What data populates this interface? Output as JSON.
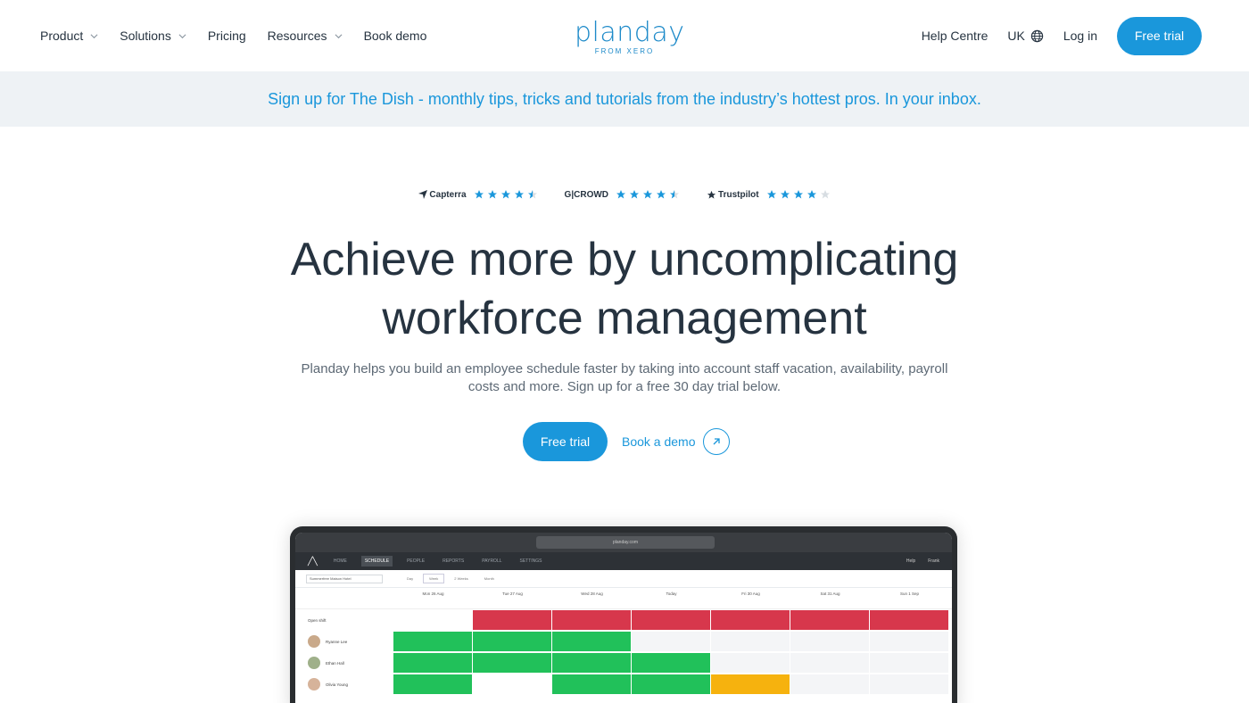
{
  "nav": {
    "items": [
      {
        "label": "Product",
        "dropdown": true
      },
      {
        "label": "Solutions",
        "dropdown": true
      },
      {
        "label": "Pricing",
        "dropdown": false
      },
      {
        "label": "Resources",
        "dropdown": true
      },
      {
        "label": "Book demo",
        "dropdown": false
      }
    ],
    "logo_main": "planday",
    "logo_sub": "FROM XERO",
    "help_centre": "Help Centre",
    "region": "UK",
    "login": "Log in",
    "trial": "Free trial"
  },
  "banner": {
    "text": "Sign up for The Dish - monthly tips, tricks and tutorials from the industry’s hottest pros. In your inbox."
  },
  "ratings": [
    {
      "brand": "Capterra",
      "stars": 4.5
    },
    {
      "brand": "G|CROWD",
      "stars": 4.5
    },
    {
      "brand": "Trustpilot",
      "stars": 4
    }
  ],
  "hero": {
    "title_line1": "Achieve more by uncomplicating",
    "title_line2": "workforce management",
    "subtitle": "Planday helps you build an employee schedule faster by taking into account staff vacation, availability, payroll costs and more. Sign up for a free 30 day trial below.",
    "primary_cta": "Free trial",
    "secondary_cta": "Book a demo"
  },
  "app_preview": {
    "url": "planday.com",
    "tabs": [
      "HOME",
      "SCHEDULE",
      "PEOPLE",
      "REPORTS",
      "PAYROLL",
      "SETTINGS"
    ],
    "active_tab": "SCHEDULE",
    "right_items": [
      "Help",
      "Frank"
    ],
    "department": "Summerfree Maison Hotel",
    "views": [
      "Day",
      "Week",
      "2 Weeks",
      "Month"
    ],
    "active_view": "Week",
    "days": [
      "Mon 26 Aug",
      "Tue 27 Aug",
      "Wed 28 Aug",
      "Today",
      "Fri 30 Aug",
      "Sat 31 Aug",
      "Sun 1 Sep"
    ],
    "rows": [
      {
        "name": "Open shift",
        "cells": [
          "",
          "red",
          "red",
          "red",
          "red",
          "red",
          "red"
        ]
      },
      {
        "name": "Ryanne Lee",
        "cells": [
          "green",
          "green",
          "green",
          "blank",
          "blank",
          "blank",
          "blank"
        ]
      },
      {
        "name": "Ethan Hall",
        "cells": [
          "green",
          "green",
          "green",
          "green",
          "blank",
          "blank",
          "blank"
        ]
      },
      {
        "name": "Olivia Young",
        "cells": [
          "green",
          "",
          "green",
          "green",
          "yellow",
          "blank",
          "blank"
        ]
      }
    ],
    "colors": {
      "red": "#d7374c",
      "green": "#21c15a",
      "yellow": "#f6b20e"
    }
  },
  "colors": {
    "accent": "#1a97db",
    "text": "#263340",
    "banner_bg": "#eef2f5"
  }
}
